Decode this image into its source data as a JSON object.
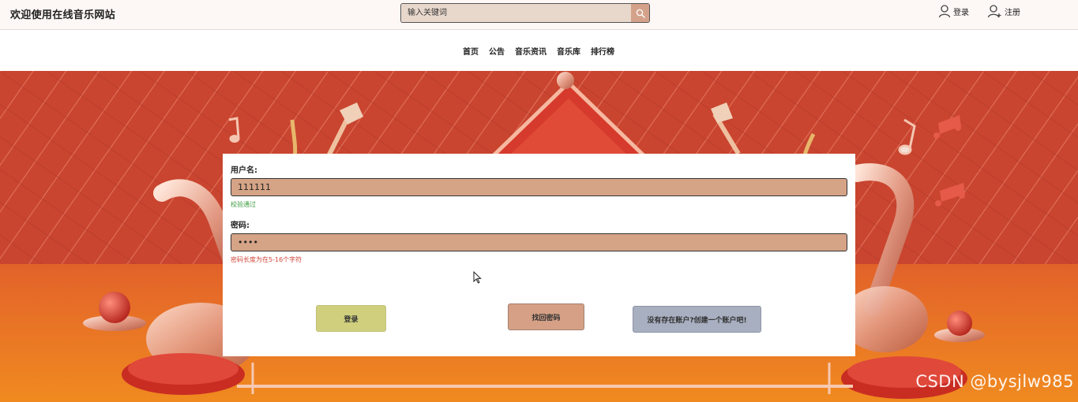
{
  "header": {
    "site_title": "欢迎使用在线音乐网站",
    "search": {
      "placeholder": "输入关键词",
      "value": ""
    },
    "login_label": "登录",
    "register_label": "注册"
  },
  "nav": {
    "items": [
      "首页",
      "公告",
      "音乐资讯",
      "音乐库",
      "排行榜"
    ]
  },
  "form": {
    "username_label": "用户名:",
    "username_value": "111111",
    "username_hint": "校验通过",
    "password_label": "密码:",
    "password_value": "••••",
    "password_hint": "密码长度为在5-16个字符",
    "login_button": "登录",
    "find_password_button": "找回密码",
    "register_button": "没有存在账户?创建一个账户吧!"
  },
  "watermark": "CSDN @bysjlw985",
  "colors": {
    "hero_red": "#d24e32",
    "input_bg": "#d5a386",
    "login_btn": "#cfcf7e",
    "find_btn": "#d5a085",
    "register_btn": "#a8afc0",
    "hint_ok": "#3c9b3c",
    "hint_err": "#d24638"
  }
}
